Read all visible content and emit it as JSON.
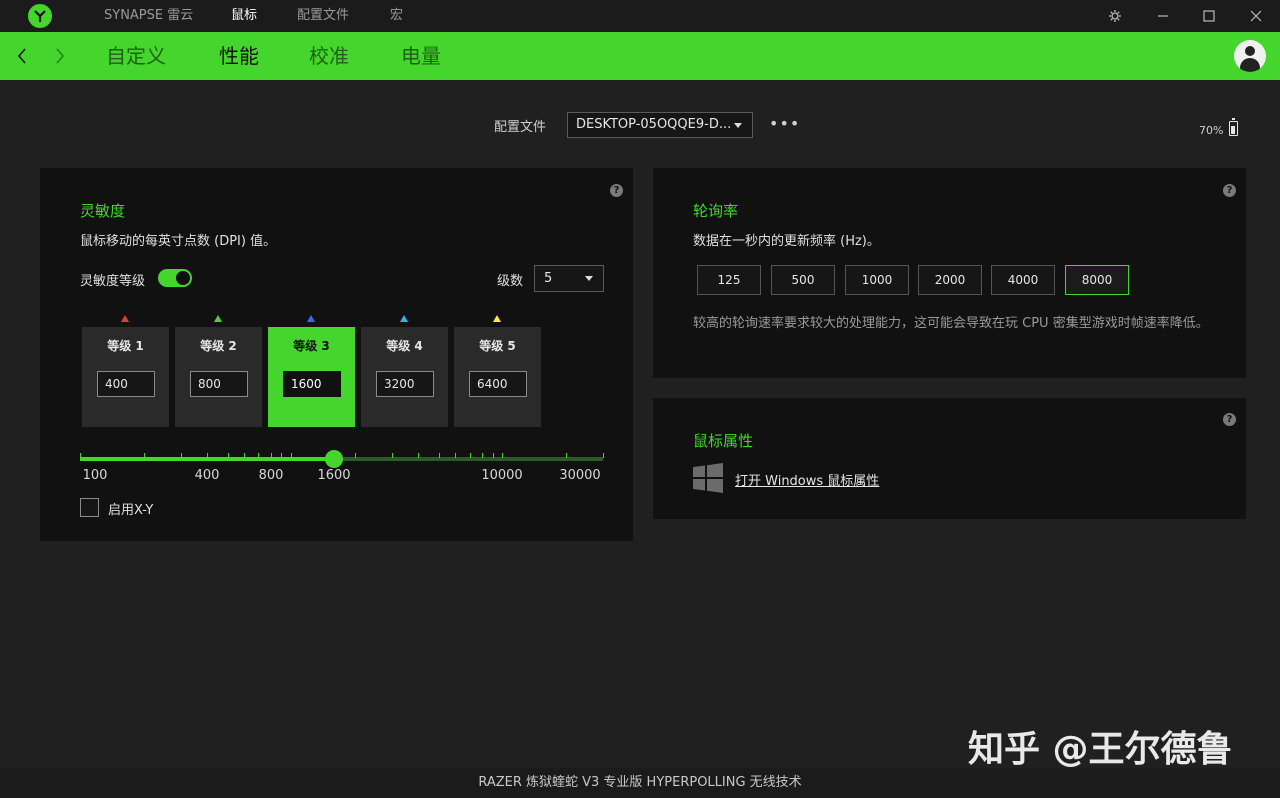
{
  "topnav": {
    "brand": "SYNAPSE 雷云",
    "items": [
      "鼠标",
      "配置文件",
      "宏"
    ],
    "active": "鼠标"
  },
  "subnav": {
    "items": [
      "自定义",
      "性能",
      "校准",
      "电量"
    ],
    "active": "性能"
  },
  "profile": {
    "label": "配置文件",
    "value": "DESKTOP-05OQQE9-D...",
    "more": "•••"
  },
  "battery": {
    "percent_text": "70%",
    "level": 0.7
  },
  "sensitivity": {
    "title": "灵敏度",
    "desc": "鼠标移动的每英寸点数 (DPI) 值。",
    "toggle_label": "灵敏度等级",
    "toggle_on": true,
    "levels_label": "级数",
    "levels_value": "5",
    "stages": [
      {
        "name": "等级 1",
        "value": "400",
        "color": "#e53935",
        "active": false
      },
      {
        "name": "等级 2",
        "value": "800",
        "color": "#44d62c",
        "active": false
      },
      {
        "name": "等级 3",
        "value": "1600",
        "color": "#2f6bff",
        "active": true
      },
      {
        "name": "等级 4",
        "value": "3200",
        "color": "#29b6f6",
        "active": false
      },
      {
        "name": "等级 5",
        "value": "6400",
        "color": "#ffeb3b",
        "active": false
      }
    ],
    "slider": {
      "min": 100,
      "max": 30000,
      "value": 1600,
      "labels": [
        "100",
        "400",
        "800",
        "1600",
        "10000",
        "30000"
      ]
    },
    "xy_label": "启用X-Y",
    "xy_checked": false
  },
  "polling": {
    "title": "轮询率",
    "desc": "数据在一秒内的更新频率 (Hz)。",
    "options": [
      "125",
      "500",
      "1000",
      "2000",
      "4000",
      "8000"
    ],
    "selected": "8000",
    "note": "较高的轮询速率要求较大的处理能力，这可能会导致在玩 CPU 密集型游戏时帧速率降低。"
  },
  "mouse_props": {
    "title": "鼠标属性",
    "link": "打开 Windows 鼠标属性"
  },
  "help_glyph": "?",
  "footer": "RAZER 炼狱蝰蛇 V3 专业版 HYPERPOLLING 无线技术",
  "watermark": "知乎 @王尔德鲁",
  "colors": {
    "accent": "#44d62c",
    "panel": "#111111",
    "background": "#202020"
  }
}
